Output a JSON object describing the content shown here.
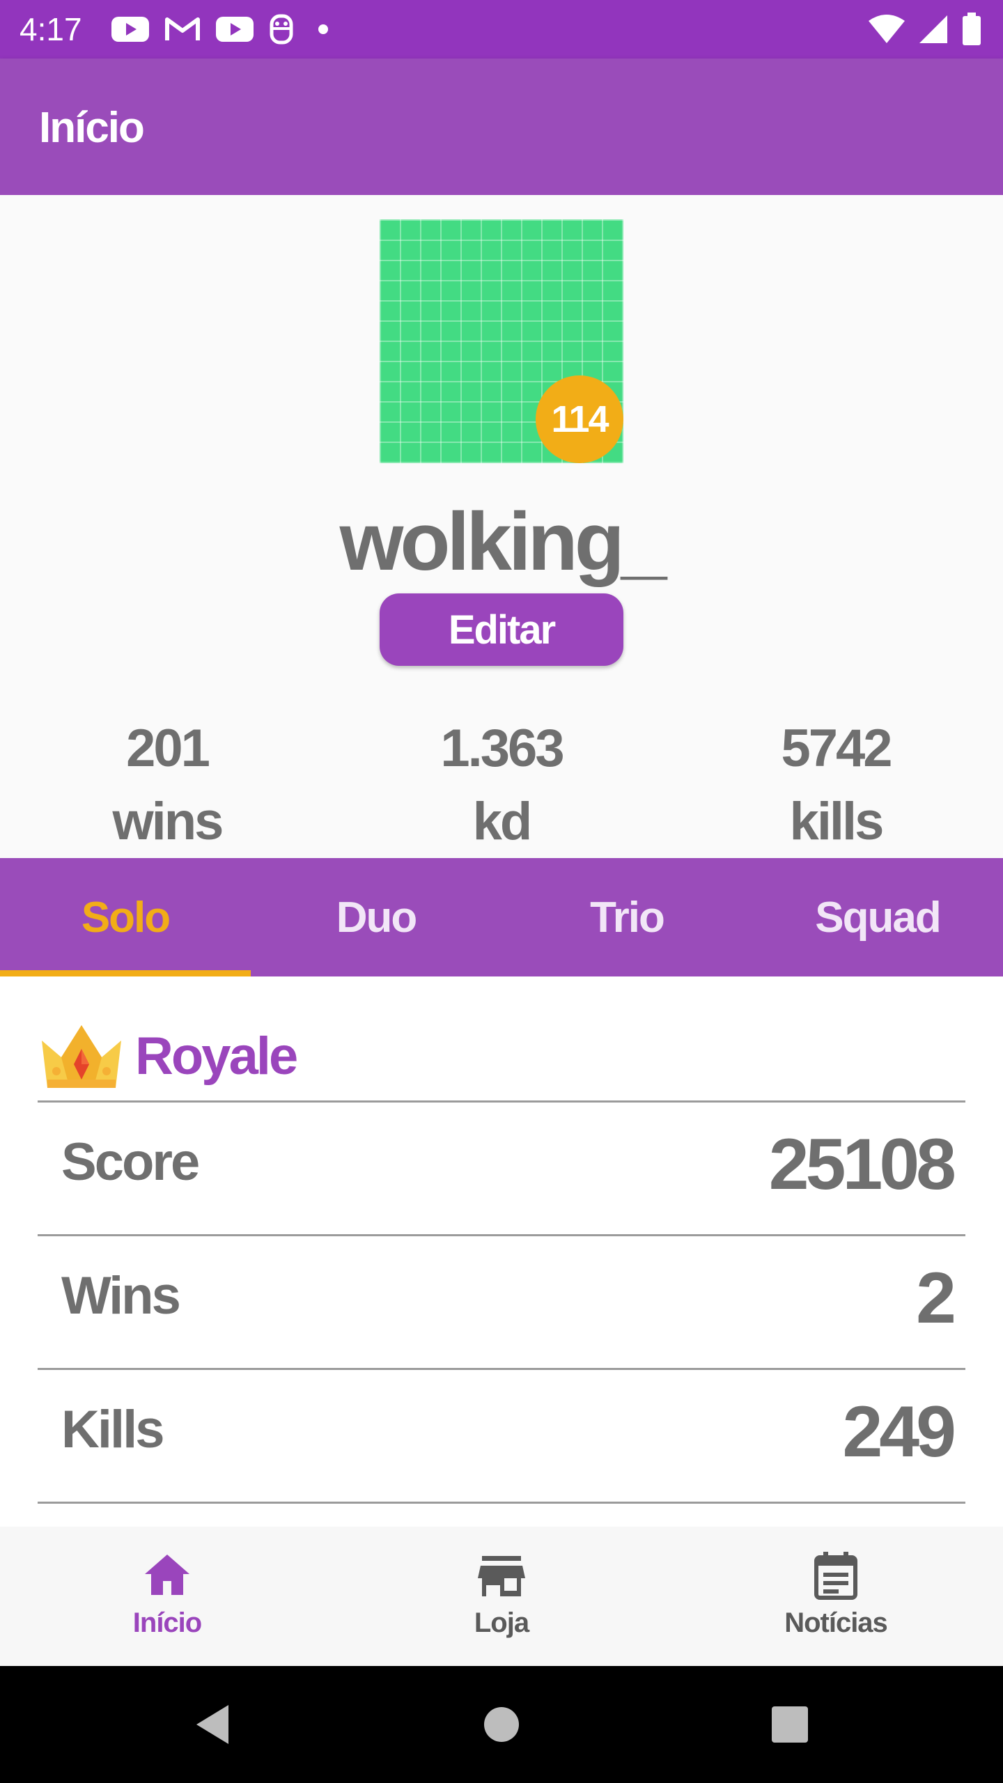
{
  "status_bar": {
    "time": "4:17",
    "notification_icons": [
      "youtube-icon",
      "gmail-icon",
      "youtube-icon",
      "assistant-icon",
      "dot-icon"
    ],
    "system_icons": [
      "wifi-icon",
      "signal-icon",
      "battery-icon"
    ]
  },
  "app_bar": {
    "title": "Início"
  },
  "profile": {
    "avatar_color": "#43db83",
    "level": "114",
    "username": "wolking_",
    "edit_label": "Editar",
    "stats": [
      {
        "value": "201",
        "label": "wins"
      },
      {
        "value": "1.363",
        "label": "kd"
      },
      {
        "value": "5742",
        "label": "kills"
      }
    ]
  },
  "tabs": {
    "items": [
      "Solo",
      "Duo",
      "Trio",
      "Squad"
    ],
    "active": "Solo",
    "accent": "#f2ad17"
  },
  "royale": {
    "title": "Royale",
    "icon": "crown-icon",
    "rows": [
      {
        "label": "Score",
        "value": "25108"
      },
      {
        "label": "Wins",
        "value": "2"
      },
      {
        "label": "Kills",
        "value": "249"
      }
    ]
  },
  "bottom_nav": {
    "items": [
      {
        "label": "Início",
        "icon": "home-icon",
        "active": true
      },
      {
        "label": "Loja",
        "icon": "store-icon",
        "active": false
      },
      {
        "label": "Notícias",
        "icon": "calendar-icon",
        "active": false
      }
    ]
  },
  "system_nav": [
    "back-icon",
    "home-circle-icon",
    "recents-icon"
  ],
  "colors": {
    "primary": "#9a4cba",
    "status_bar": "#9235bd",
    "accent": "#f2ad17",
    "text_gray": "#6f6f6f"
  }
}
